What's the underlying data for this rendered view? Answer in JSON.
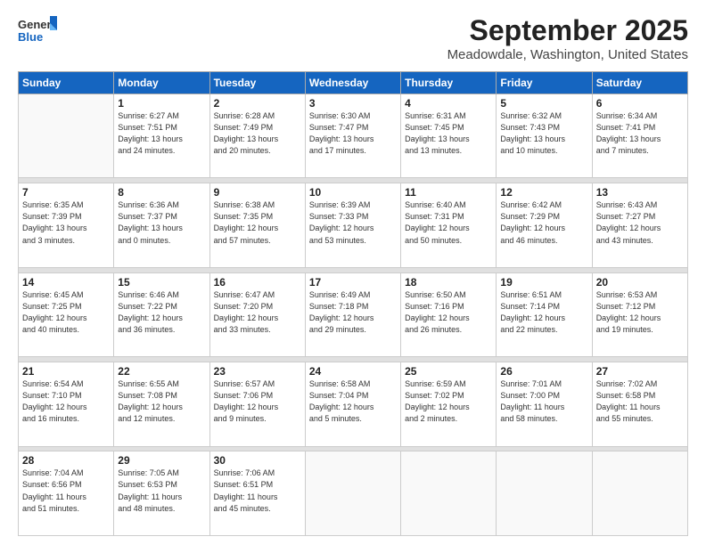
{
  "logo": {
    "general": "General",
    "blue": "Blue"
  },
  "title": "September 2025",
  "subtitle": "Meadowdale, Washington, United States",
  "headers": [
    "Sunday",
    "Monday",
    "Tuesday",
    "Wednesday",
    "Thursday",
    "Friday",
    "Saturday"
  ],
  "weeks": [
    [
      {
        "day": "",
        "info": ""
      },
      {
        "day": "1",
        "info": "Sunrise: 6:27 AM\nSunset: 7:51 PM\nDaylight: 13 hours\nand 24 minutes."
      },
      {
        "day": "2",
        "info": "Sunrise: 6:28 AM\nSunset: 7:49 PM\nDaylight: 13 hours\nand 20 minutes."
      },
      {
        "day": "3",
        "info": "Sunrise: 6:30 AM\nSunset: 7:47 PM\nDaylight: 13 hours\nand 17 minutes."
      },
      {
        "day": "4",
        "info": "Sunrise: 6:31 AM\nSunset: 7:45 PM\nDaylight: 13 hours\nand 13 minutes."
      },
      {
        "day": "5",
        "info": "Sunrise: 6:32 AM\nSunset: 7:43 PM\nDaylight: 13 hours\nand 10 minutes."
      },
      {
        "day": "6",
        "info": "Sunrise: 6:34 AM\nSunset: 7:41 PM\nDaylight: 13 hours\nand 7 minutes."
      }
    ],
    [
      {
        "day": "7",
        "info": "Sunrise: 6:35 AM\nSunset: 7:39 PM\nDaylight: 13 hours\nand 3 minutes."
      },
      {
        "day": "8",
        "info": "Sunrise: 6:36 AM\nSunset: 7:37 PM\nDaylight: 13 hours\nand 0 minutes."
      },
      {
        "day": "9",
        "info": "Sunrise: 6:38 AM\nSunset: 7:35 PM\nDaylight: 12 hours\nand 57 minutes."
      },
      {
        "day": "10",
        "info": "Sunrise: 6:39 AM\nSunset: 7:33 PM\nDaylight: 12 hours\nand 53 minutes."
      },
      {
        "day": "11",
        "info": "Sunrise: 6:40 AM\nSunset: 7:31 PM\nDaylight: 12 hours\nand 50 minutes."
      },
      {
        "day": "12",
        "info": "Sunrise: 6:42 AM\nSunset: 7:29 PM\nDaylight: 12 hours\nand 46 minutes."
      },
      {
        "day": "13",
        "info": "Sunrise: 6:43 AM\nSunset: 7:27 PM\nDaylight: 12 hours\nand 43 minutes."
      }
    ],
    [
      {
        "day": "14",
        "info": "Sunrise: 6:45 AM\nSunset: 7:25 PM\nDaylight: 12 hours\nand 40 minutes."
      },
      {
        "day": "15",
        "info": "Sunrise: 6:46 AM\nSunset: 7:22 PM\nDaylight: 12 hours\nand 36 minutes."
      },
      {
        "day": "16",
        "info": "Sunrise: 6:47 AM\nSunset: 7:20 PM\nDaylight: 12 hours\nand 33 minutes."
      },
      {
        "day": "17",
        "info": "Sunrise: 6:49 AM\nSunset: 7:18 PM\nDaylight: 12 hours\nand 29 minutes."
      },
      {
        "day": "18",
        "info": "Sunrise: 6:50 AM\nSunset: 7:16 PM\nDaylight: 12 hours\nand 26 minutes."
      },
      {
        "day": "19",
        "info": "Sunrise: 6:51 AM\nSunset: 7:14 PM\nDaylight: 12 hours\nand 22 minutes."
      },
      {
        "day": "20",
        "info": "Sunrise: 6:53 AM\nSunset: 7:12 PM\nDaylight: 12 hours\nand 19 minutes."
      }
    ],
    [
      {
        "day": "21",
        "info": "Sunrise: 6:54 AM\nSunset: 7:10 PM\nDaylight: 12 hours\nand 16 minutes."
      },
      {
        "day": "22",
        "info": "Sunrise: 6:55 AM\nSunset: 7:08 PM\nDaylight: 12 hours\nand 12 minutes."
      },
      {
        "day": "23",
        "info": "Sunrise: 6:57 AM\nSunset: 7:06 PM\nDaylight: 12 hours\nand 9 minutes."
      },
      {
        "day": "24",
        "info": "Sunrise: 6:58 AM\nSunset: 7:04 PM\nDaylight: 12 hours\nand 5 minutes."
      },
      {
        "day": "25",
        "info": "Sunrise: 6:59 AM\nSunset: 7:02 PM\nDaylight: 12 hours\nand 2 minutes."
      },
      {
        "day": "26",
        "info": "Sunrise: 7:01 AM\nSunset: 7:00 PM\nDaylight: 11 hours\nand 58 minutes."
      },
      {
        "day": "27",
        "info": "Sunrise: 7:02 AM\nSunset: 6:58 PM\nDaylight: 11 hours\nand 55 minutes."
      }
    ],
    [
      {
        "day": "28",
        "info": "Sunrise: 7:04 AM\nSunset: 6:56 PM\nDaylight: 11 hours\nand 51 minutes."
      },
      {
        "day": "29",
        "info": "Sunrise: 7:05 AM\nSunset: 6:53 PM\nDaylight: 11 hours\nand 48 minutes."
      },
      {
        "day": "30",
        "info": "Sunrise: 7:06 AM\nSunset: 6:51 PM\nDaylight: 11 hours\nand 45 minutes."
      },
      {
        "day": "",
        "info": ""
      },
      {
        "day": "",
        "info": ""
      },
      {
        "day": "",
        "info": ""
      },
      {
        "day": "",
        "info": ""
      }
    ]
  ]
}
